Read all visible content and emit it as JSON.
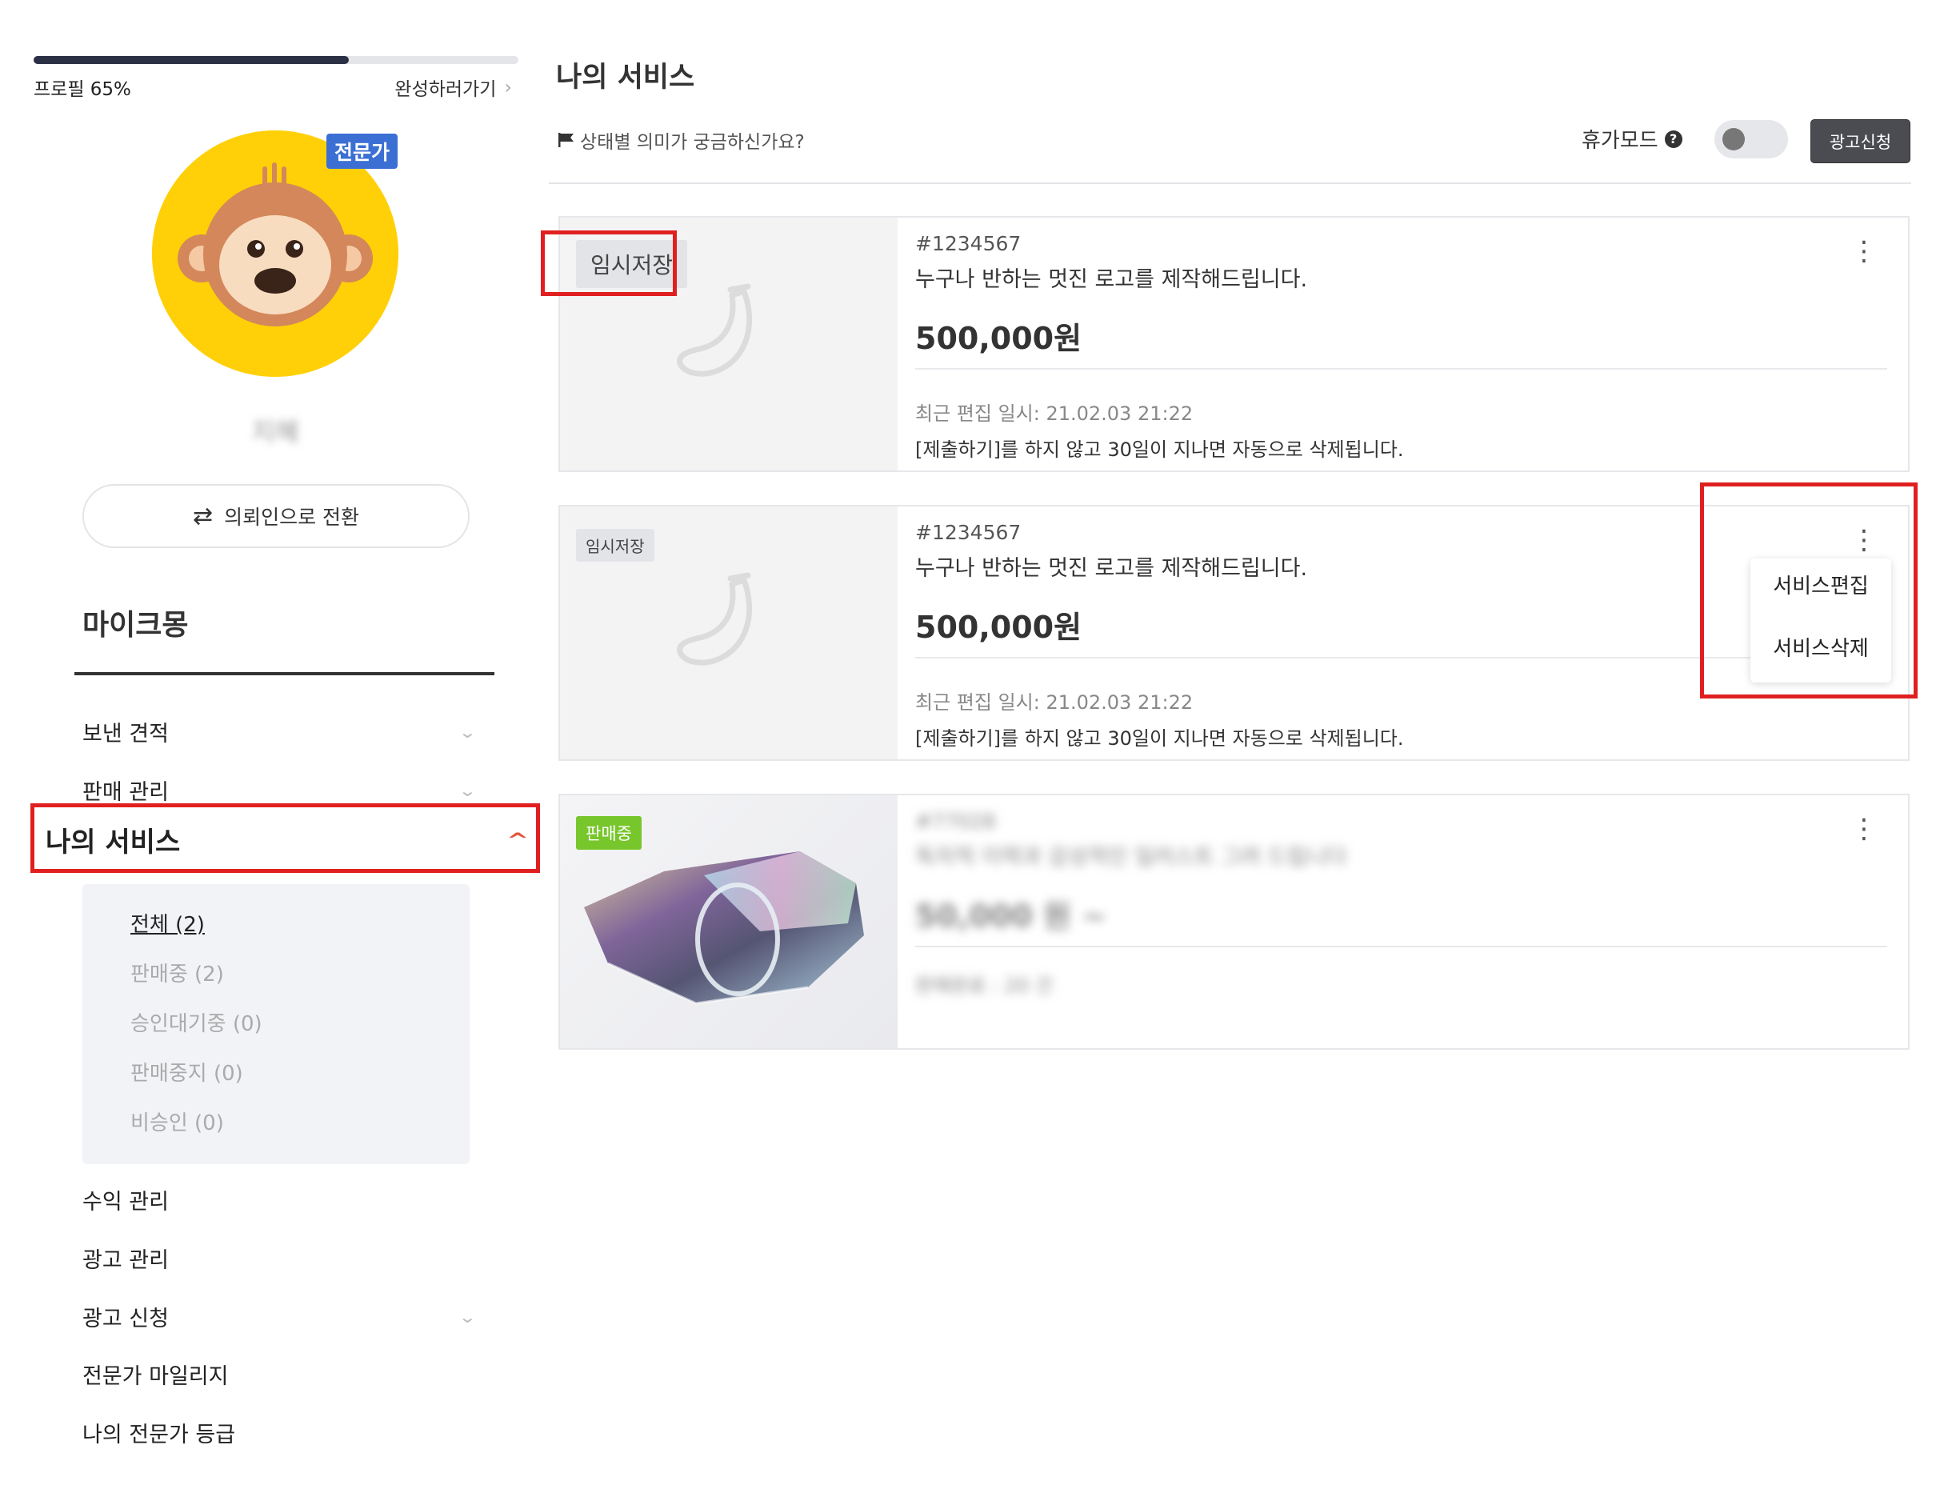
{
  "profile": {
    "progress_label": "프로필 65%",
    "progress_fraction": 0.65,
    "complete_link": "완성하러가기",
    "badge": "전문가",
    "username": "지혜",
    "switch_button": "의뢰인으로 전환"
  },
  "sidebar": {
    "section_title": "마이크몽",
    "items_top": [
      {
        "label": "보낸 견적",
        "expandable": true
      },
      {
        "label": "판매 관리",
        "expandable": true
      }
    ],
    "active_item": "나의 서비스",
    "sub_items": [
      {
        "label": "전체 (2)",
        "active": true
      },
      {
        "label": "판매중 (2)",
        "active": false
      },
      {
        "label": "승인대기중 (0)",
        "active": false
      },
      {
        "label": "판매중지 (0)",
        "active": false
      },
      {
        "label": "비승인 (0)",
        "active": false
      }
    ],
    "items_bottom": [
      {
        "label": "수익 관리",
        "expandable": false
      },
      {
        "label": "광고 관리",
        "expandable": false
      },
      {
        "label": "광고 신청",
        "expandable": true
      },
      {
        "label": "전문가 마일리지",
        "expandable": false
      },
      {
        "label": "나의 전문가 등급",
        "expandable": false
      }
    ]
  },
  "main": {
    "title": "나의 서비스",
    "status_help": "상태별 의미가 궁금하신가요?",
    "vacation_label": "휴가모드",
    "vacation_on": false,
    "ad_button": "광고신청"
  },
  "services": [
    {
      "badge": "임시저장",
      "id": "#1234567",
      "title": "누구나 반하는 멋진 로고를 제작해드립니다.",
      "price": "500,000원",
      "edited": "최근 편집 일시: 21.02.03 21:22",
      "note": "[제출하기]를 하지 않고 30일이 지나면 자동으로 삭제됩니다."
    },
    {
      "badge": "임시저장",
      "id": "#1234567",
      "title": "누구나 반하는 멋진 로고를 제작해드립니다.",
      "price": "500,000원",
      "edited": "최근 편집 일시: 21.02.03 21:22",
      "note": "[제출하기]를 하지 않고 30일이 지나면 자동으로 삭제됩니다."
    },
    {
      "badge": "판매중",
      "id": "#77028",
      "title": "독자적 이력과 감성적인 일러스트 그려 드립니다",
      "price": "50,000 원 ~",
      "sales": "판매완료 : 20 건"
    }
  ],
  "dropdown": {
    "items": [
      "서비스편집",
      "서비스삭제"
    ]
  },
  "colors": {
    "accent_red": "#e02020",
    "selling_green": "#77c62b",
    "expert_blue": "#3b6fd4",
    "progress_dark": "#2b3044"
  },
  "icons": {
    "more": "more-vertical-icon",
    "switch": "swap-arrows-icon",
    "flag": "flag-icon",
    "help": "question-circle-icon"
  }
}
